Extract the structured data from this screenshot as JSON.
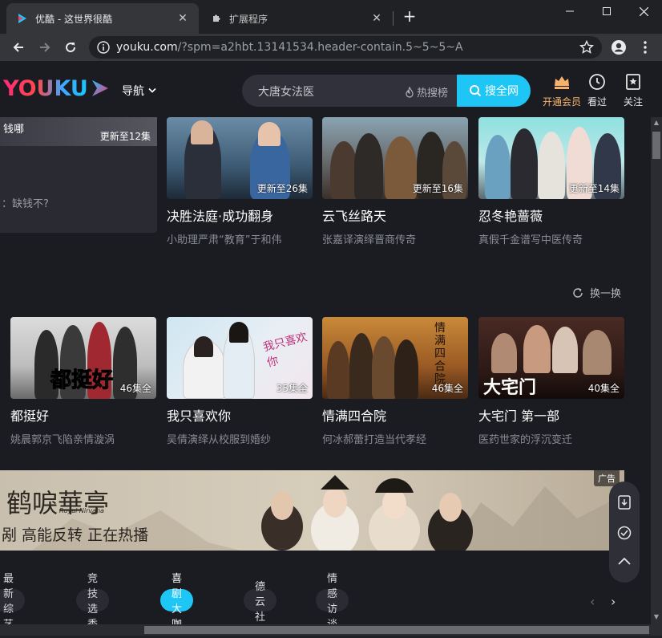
{
  "browser": {
    "tabs": [
      {
        "label": "优酷 - 这世界很酷",
        "active": true
      },
      {
        "label": "扩展程序",
        "active": false
      }
    ],
    "url_host": "youku.com",
    "url_path": "/?spm=a2hbt.13141534.header-contain.5~5~5~A"
  },
  "header": {
    "logo": "YOUKU",
    "nav_label": "导航",
    "search_placeholder": "大唐女法医",
    "hot_rank": "热搜榜",
    "search_button": "搜全网",
    "actions": [
      {
        "label": "开通会员",
        "icon": "vip-crown-icon"
      },
      {
        "label": "看过",
        "icon": "history-icon"
      },
      {
        "label": "关注",
        "icon": "follow-icon"
      }
    ]
  },
  "side_card": {
    "title_fragment": "钱哪",
    "badge": "更新至12集",
    "sub_fragment": "：缺钱不?"
  },
  "row1": [
    {
      "title": "决胜法庭·成功翻身",
      "sub": "小助理严肃“教育”于和伟",
      "badge": "更新至26集"
    },
    {
      "title": "云飞丝路天",
      "sub": "张嘉译演绎晋商传奇",
      "badge": "更新至16集"
    },
    {
      "title": "忍冬艳蔷薇",
      "sub": "真假千金谱写中医传奇",
      "badge": "更新至14集"
    }
  ],
  "refresh_label": "换一换",
  "row2": [
    {
      "title": "都挺好",
      "sub": "姚晨郭京飞陷亲情漩涡",
      "badge": "46集全",
      "art": "都挺好"
    },
    {
      "title": "我只喜欢你",
      "sub": "吴倩演绎从校服到婚纱",
      "badge": "35集全",
      "art": "我只喜欢你"
    },
    {
      "title": "情满四合院",
      "sub": "何冰郝蕾打造当代孝经",
      "badge": "46集全",
      "art": "情满四合院"
    },
    {
      "title": "大宅门 第一部",
      "sub": "医药世家的浮沉变迁",
      "badge": "40集全",
      "art": "大宅门"
    }
  ],
  "ad": {
    "label": "广告",
    "calligraphy": "鹤唳華亭",
    "english": "Royal Nirvana",
    "tagline": "剐 高能反转 正在热播"
  },
  "chips": [
    "最新综艺",
    "竞技选秀",
    "喜剧大咖",
    "德云社",
    "情感访谈"
  ],
  "active_chip": "喜剧大咖",
  "colors": {
    "accent": "#1ec6f6",
    "vip": "#f8b36b",
    "bg": "#1b1c22"
  }
}
